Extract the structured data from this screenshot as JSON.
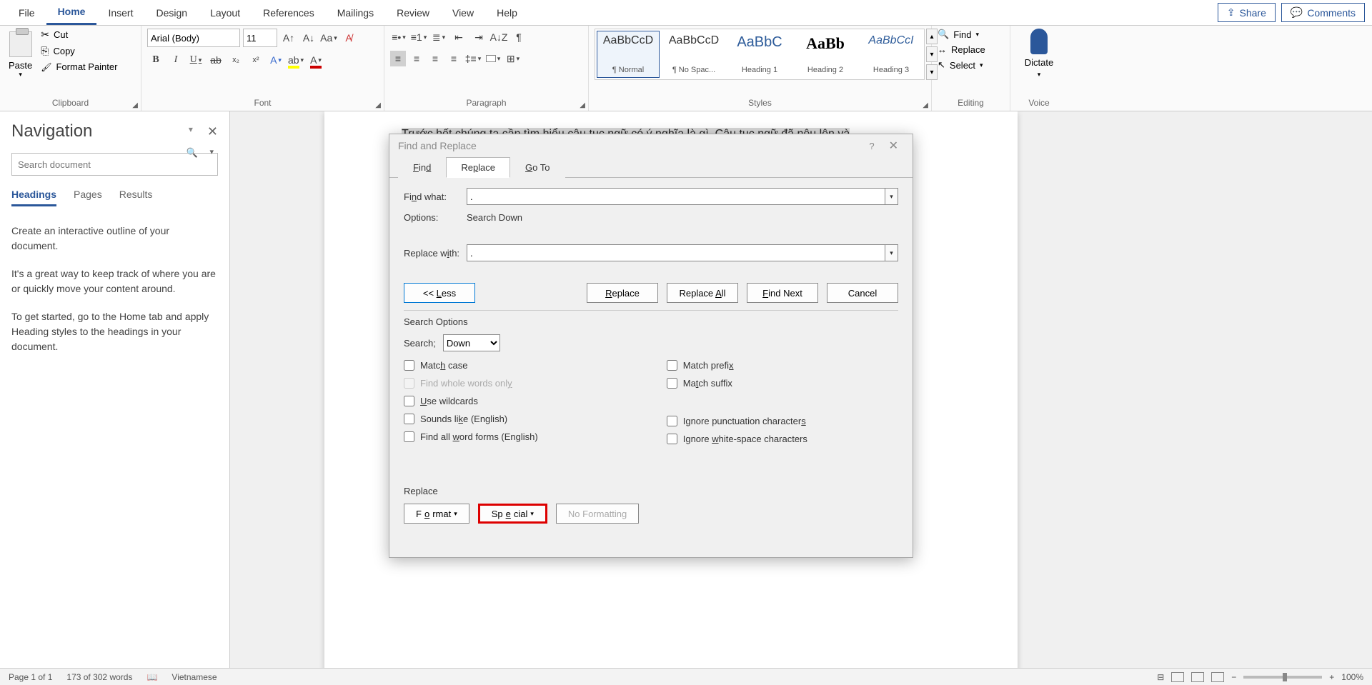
{
  "tabs": {
    "file": "File",
    "home": "Home",
    "insert": "Insert",
    "design": "Design",
    "layout": "Layout",
    "references": "References",
    "mailings": "Mailings",
    "review": "Review",
    "view": "View",
    "help": "Help"
  },
  "share_btn": "Share",
  "comments_btn": "Comments",
  "clipboard": {
    "paste": "Paste",
    "cut": "Cut",
    "copy": "Copy",
    "format_painter": "Format Painter",
    "group": "Clipboard"
  },
  "font": {
    "name": "Arial (Body)",
    "size": "11",
    "group": "Font"
  },
  "paragraph": {
    "group": "Paragraph"
  },
  "styles": {
    "items": [
      {
        "preview": "AaBbCcD",
        "name": "¶ Normal"
      },
      {
        "preview": "AaBbCcD",
        "name": "¶ No Spac..."
      },
      {
        "preview": "AaBbC",
        "name": "Heading 1"
      },
      {
        "preview": "AaBb",
        "name": "Heading 2"
      },
      {
        "preview": "AaBbCcI",
        "name": "Heading 3"
      }
    ],
    "group": "Styles"
  },
  "editing": {
    "find": "Find",
    "replace": "Replace",
    "select": "Select",
    "group": "Editing"
  },
  "voice": {
    "dictate": "Dictate",
    "group": "Voice"
  },
  "nav": {
    "title": "Navigation",
    "search_placeholder": "Search document",
    "tab_headings": "Headings",
    "tab_pages": "Pages",
    "tab_results": "Results",
    "para1": "Create an interactive outline of your document.",
    "para2": "It's a great way to keep track of where you are or quickly move your content around.",
    "para3": "To get started, go to the Home tab and apply Heading styles to the headings in your document."
  },
  "doc": {
    "line1": "Trước hết chúng ta cần tìm hiểu câu tục ngữ có ý nghĩa là gì. Câu tục ngữ đã nêu lên và"
  },
  "dialog": {
    "title": "Find and Replace",
    "tab_find": "Find",
    "tab_replace": "Replace",
    "tab_goto": "Go To",
    "find_what_label": "Find what:",
    "find_what_value": ".",
    "options_label": "Options:",
    "options_value": "Search Down",
    "replace_with_label": "Replace with:",
    "replace_with_value": ".",
    "less_btn": "<< Less",
    "replace_btn": "Replace",
    "replace_all_btn": "Replace All",
    "find_next_btn": "Find Next",
    "cancel_btn": "Cancel",
    "search_options": "Search Options",
    "search_label": "Search;",
    "search_dir": "Down",
    "chk_match_case": "Match case",
    "chk_whole_words": "Find whole words only",
    "chk_wildcards": "Use wildcards",
    "chk_sounds_like": "Sounds like (English)",
    "chk_word_forms": "Find all word forms (English)",
    "chk_prefix": "Match prefix",
    "chk_suffix": "Match suffix",
    "chk_punct": "Ignore punctuation characters",
    "chk_ws": "Ignore white-space characters",
    "replace_section": "Replace",
    "format_btn": "Format",
    "special_btn": "Special",
    "no_formatting_btn": "No Formatting"
  },
  "status": {
    "page": "Page 1 of 1",
    "words": "173 of 302 words",
    "lang": "Vietnamese",
    "zoom": "100%"
  }
}
